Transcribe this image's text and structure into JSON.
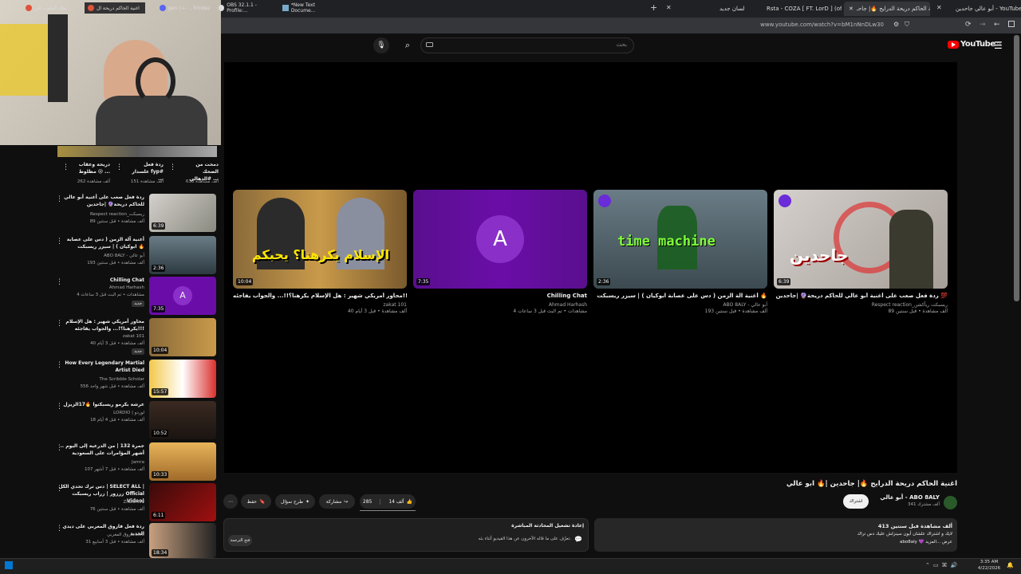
{
  "tabs": [
    {
      "label": "أبو عالي جاحدين - YouTube"
    },
    {
      "label": "اغنية الحاكم دريحة الدرايح 🔥| جاحـ"
    },
    {
      "label": "Rsta - COZA [ FT. LorD ] (offic"
    },
    {
      "label": "لسان جديد"
    }
  ],
  "address": {
    "url": "www.youtube.com/watch?v=bM1nNnDLw30"
  },
  "youtube": {
    "logo": "YouTube",
    "region": "SA",
    "search_placeholder": "بحث"
  },
  "end_screen": [
    {
      "title": "ردة فعل صعب على أغنية أبو عالي للحاكم دريحة🔮 |جاحدين 💯",
      "channel": "Respect reaction_ريسبكت ريأكشن",
      "meta": "89 ألف مشاهدة • قبل سنتين",
      "duration": "6:39"
    },
    {
      "title": "أغنية آلة الزمن ( دس على عصابة ابوكيان ) | سيزر ريسبكت 🔥",
      "channel": "ABO 8ALY - أبو عالي",
      "meta": "193 ألف مشاهدة • قبل سنتين",
      "duration": "2:36",
      "thumb_text": "time machine"
    },
    {
      "title": "Chilling Chat",
      "channel": "Ahmad Harhash",
      "meta": "4 مشاهدات • تم البث قبل 3 ساعات",
      "duration": "7:35",
      "avatar": "A"
    },
    {
      "title": "محاور أمريكي شهير : هل الإسلام يكرهنا؟!!... والجواب يفاجئه!!!",
      "channel": "zakat 101",
      "meta": "40 ألف مشاهدة • قبل 3 أيام",
      "duration": "10:04",
      "thumb_text": "الإسلام يكرهنا؟ يحبكم"
    }
  ],
  "shorts": [
    {
      "title": "دريحة وعقاب مظلوط 😢 ...",
      "views": "262 ألف مشاهدة"
    },
    {
      "title": "ردة فعل علسدار fyp# ...",
      "views": "151 ألف مشاهدة"
    },
    {
      "title": "دمحت من الضحك #الدهالي ...",
      "views": "638 ألف مشاهدة"
    }
  ],
  "sidebar": [
    {
      "title": "ردة فعل صعب على أغنية أبو عالي للحاكم دريحة🔮 |جاحدين",
      "channel": "Respect reaction_ريسبكت",
      "meta": "89 ألف مشاهدة • قبل سنتين",
      "duration": "6:39"
    },
    {
      "title": "أغنية آلة الزمن ( دس على عصابة ابوكيان ) | سيزر ريسبكت 🔥",
      "channel": "ABO 8ALY - أبو عالي",
      "meta": "193 ألف مشاهدة • قبل سنتين",
      "duration": "2:36"
    },
    {
      "title": "Chilling Chat",
      "channel": "Ahmad Harhash",
      "meta": "4 مشاهدات • تم البث قبل 3 ساعات",
      "duration": "7:35",
      "badge": "جديد"
    },
    {
      "title": "محاور أمريكي شهير : هل الإسلام يكرهنا؟!... والجواب يفاجئه!!!",
      "channel": "zakat 101",
      "meta": "40 ألف مشاهدة • قبل 3 أيام",
      "duration": "10:04",
      "badge": "جديد"
    },
    {
      "title": "How Every Legendary Martial Artist Died",
      "channel": "The Scribble Scholar",
      "meta": "556 ألف مشاهدة • قبل شهر واحد",
      "duration": "15:57"
    },
    {
      "title": "عرشة بكرمو ريسبكتوا 🔥17الزيزل",
      "channel": "LORDIO | لوردو",
      "meta": "18 ألف مشاهدة • قبل 4 أيام",
      "duration": "10:52"
    },
    {
      "title": "جمرة 132 | من الدرعية إلى اليوم .. أشهر المؤامرات على السعودية",
      "channel": "Jamra",
      "meta": "107 ألف مشاهدة • قبل 7 أشهر",
      "duration": "10:33"
    },
    {
      "title": "دس ترك تحدي الكل | SELECT ALL | زرزور | زراب ريسبكت Official Video)",
      "channel": "ZRZOR96",
      "meta": "76 ألف مشاهدة • قبل سنتين",
      "duration": "6:11"
    },
    {
      "title": "ردة فعل فاروق المغربي على ديدي الجديد",
      "channel": "فاروق المغربي Live",
      "meta": "31 ألف مشاهدة • قبل 3 أسابيع",
      "duration": "18:34"
    }
  ],
  "video": {
    "title": "اغنية الحاكم دريحة الدرايح 🔥| جاحدين |🔥 ابو عالي",
    "channel": "أبو عالي - ABO 8ALY",
    "subscribers": "341 ألف مشترك",
    "subscribe_label": "اشتراك",
    "likes": "14 ألف",
    "dislikes": "285",
    "share_label": "مشاركة",
    "ask_label": "طرح سؤال",
    "save_label": "حفظ"
  },
  "description": {
    "stats": "413 ألف مشاهدة قبل سنتين",
    "line1": "لايك و اشتراك علشان أبون سينزلش عليك دس تراك",
    "line2": "abo8aly 💜 عرض ...المزيد"
  },
  "live_chat": {
    "title": "إعادة تشغيل المحادثة المباشرة",
    "subtitle": "تعرّف على ما قاله الآخرون عن هذا الفيديو أثناء بثه.",
    "open_label": "فتح الترجمة"
  },
  "taskbar": {
    "items": [
      "ملك الملوب الي ..",
      "اغنية الحاكم دريحة ال",
      "gen | ← ... frindez",
      "OBS 32.1.1 - Profile:...",
      "*New Text Docume..."
    ],
    "time": "3:35 AM",
    "date": "4/22/2026"
  },
  "colors": {
    "brand_red": "#ff0000",
    "background": "#0f0f0f",
    "purple_thumb": "#6a0da8"
  }
}
